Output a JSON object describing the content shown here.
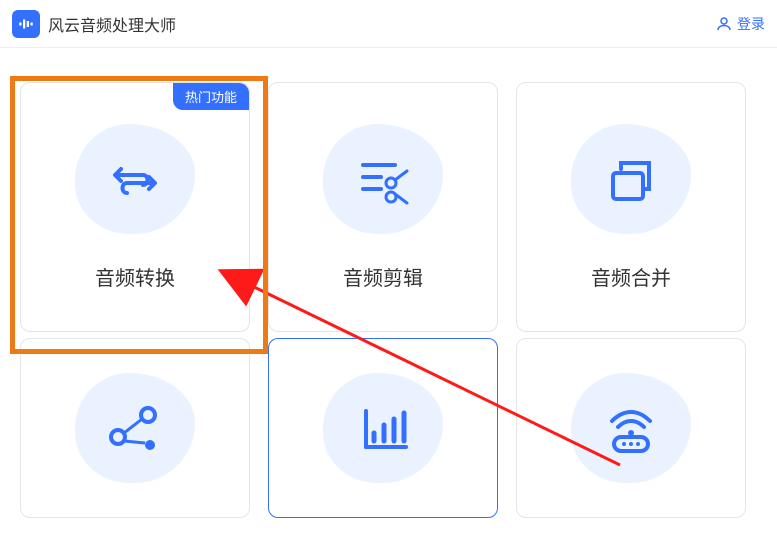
{
  "header": {
    "app_title": "风云音频处理大师",
    "login_label": "登录"
  },
  "badge": {
    "hot": "热门功能"
  },
  "cards": {
    "convert": {
      "label": "音频转换",
      "icon": "swap-icon"
    },
    "edit": {
      "label": "音频剪辑",
      "icon": "cut-icon"
    },
    "merge": {
      "label": "音频合并",
      "icon": "stack-icon"
    },
    "share": {
      "label": "",
      "icon": "nodes-icon"
    },
    "stats": {
      "label": "",
      "icon": "bars-icon"
    },
    "wifi": {
      "label": "",
      "icon": "wifi-icon"
    }
  },
  "colors": {
    "accent": "#3370ff",
    "highlight": "#ee7a16",
    "arrow": "#ff1a1a"
  }
}
